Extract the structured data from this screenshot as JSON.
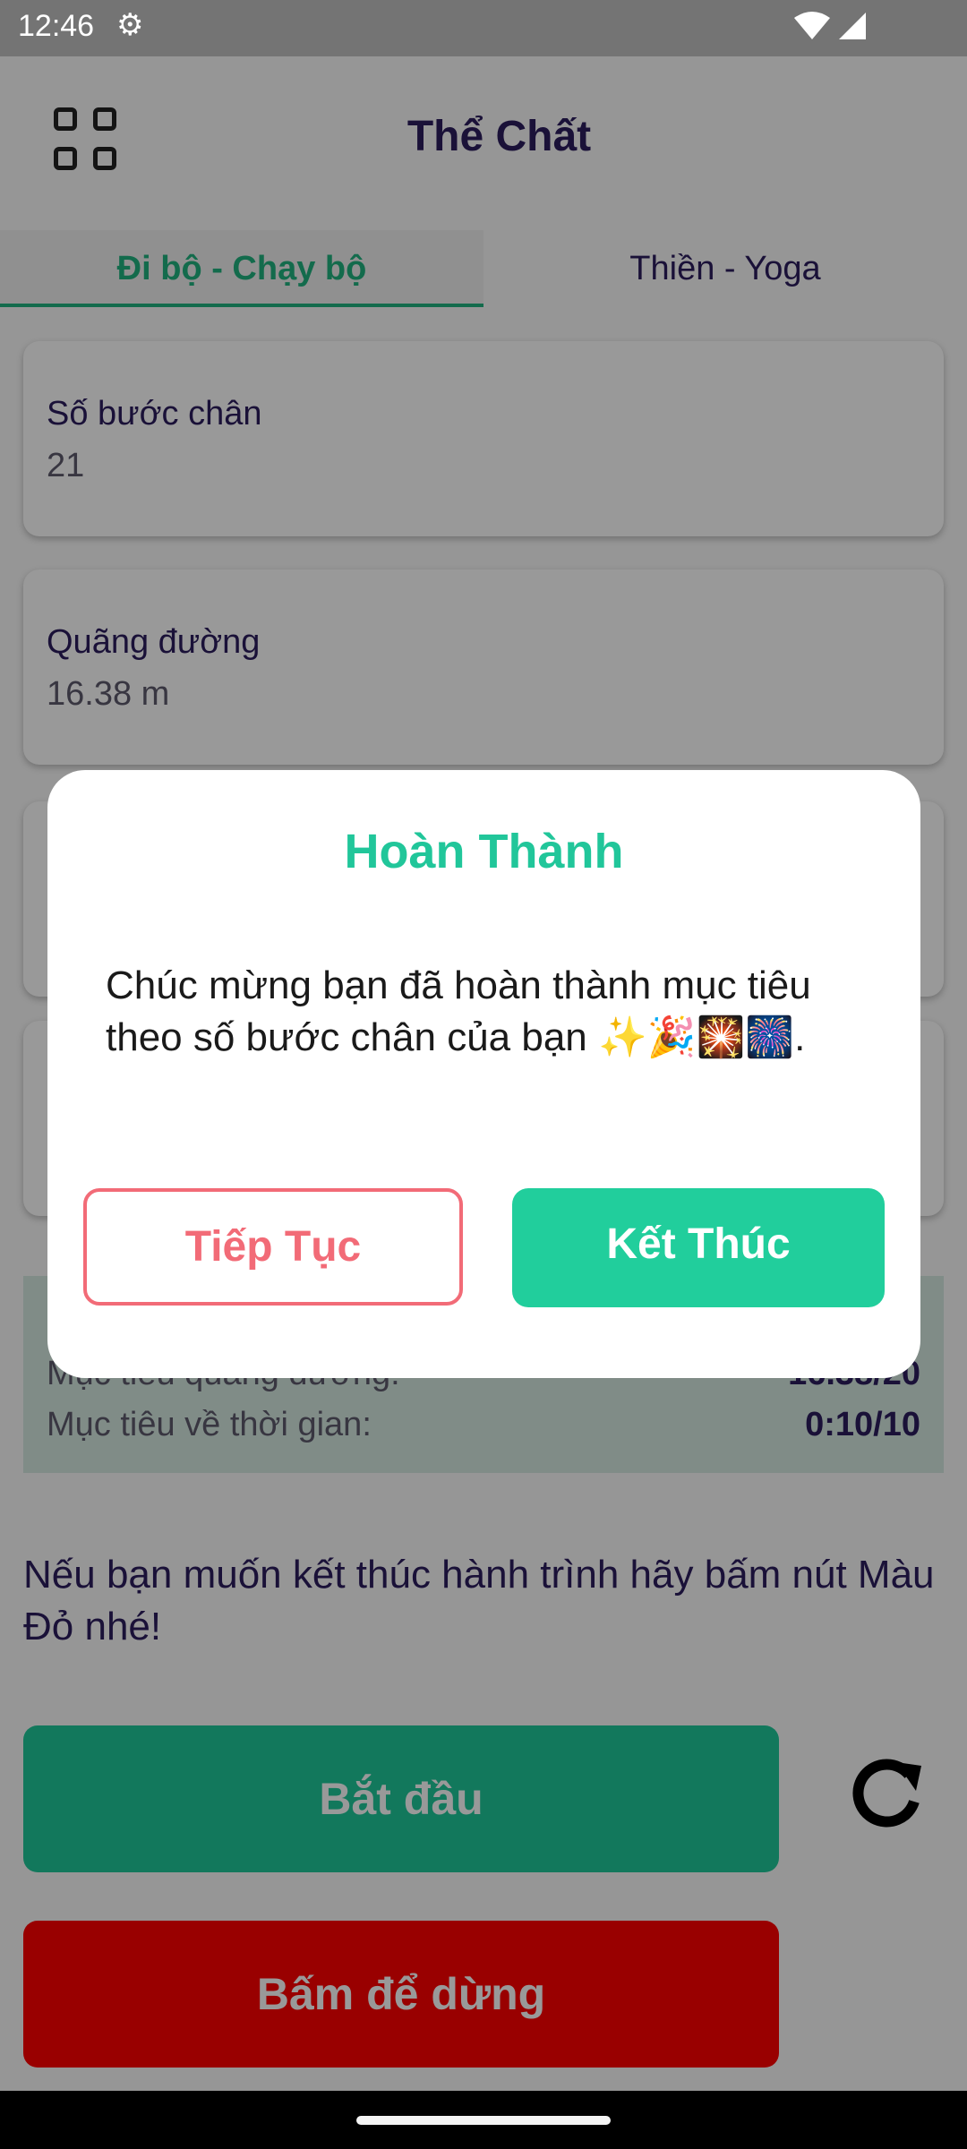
{
  "status_bar": {
    "time": "12:46",
    "settings_icon": "gear-icon",
    "wifi_icon": "wifi-icon",
    "signal_icon": "signal-icon"
  },
  "app_bar": {
    "title": "Thể Chất",
    "menu_icon": "grid-icon"
  },
  "tabs": [
    {
      "label": "Đi bộ - Chạy bộ",
      "selected": true
    },
    {
      "label": "Thiền - Yoga",
      "selected": false
    }
  ],
  "cards": [
    {
      "label": "Số bước chân",
      "value": "21"
    },
    {
      "label": "Quãng đường",
      "value": "16.38 m"
    }
  ],
  "goals": [
    {
      "label": "Mục tiêu quãng đường:",
      "value": "16.38/20"
    },
    {
      "label": "Mục tiêu về thời gian:",
      "value": "0:10/10"
    }
  ],
  "note": "Nếu bạn muốn kết thúc hành trình hãy bấm nút Màu Đỏ nhé!",
  "buttons": {
    "start": "Bắt đầu",
    "stop": "Bấm để dừng",
    "reload_icon": "refresh-icon"
  },
  "dialog": {
    "title": "Hoàn Thành",
    "message": "Chúc mừng bạn đã hoàn thành mục tiêu theo số bước chân của bạn ✨🎉🎇🎆.",
    "continue_label": "Tiếp Tục",
    "finish_label": "Kết Thúc"
  },
  "colors": {
    "accent": "#21ce9c",
    "title": "#2c1d5e",
    "danger": "#ff0000",
    "outline": "#f26b77"
  }
}
